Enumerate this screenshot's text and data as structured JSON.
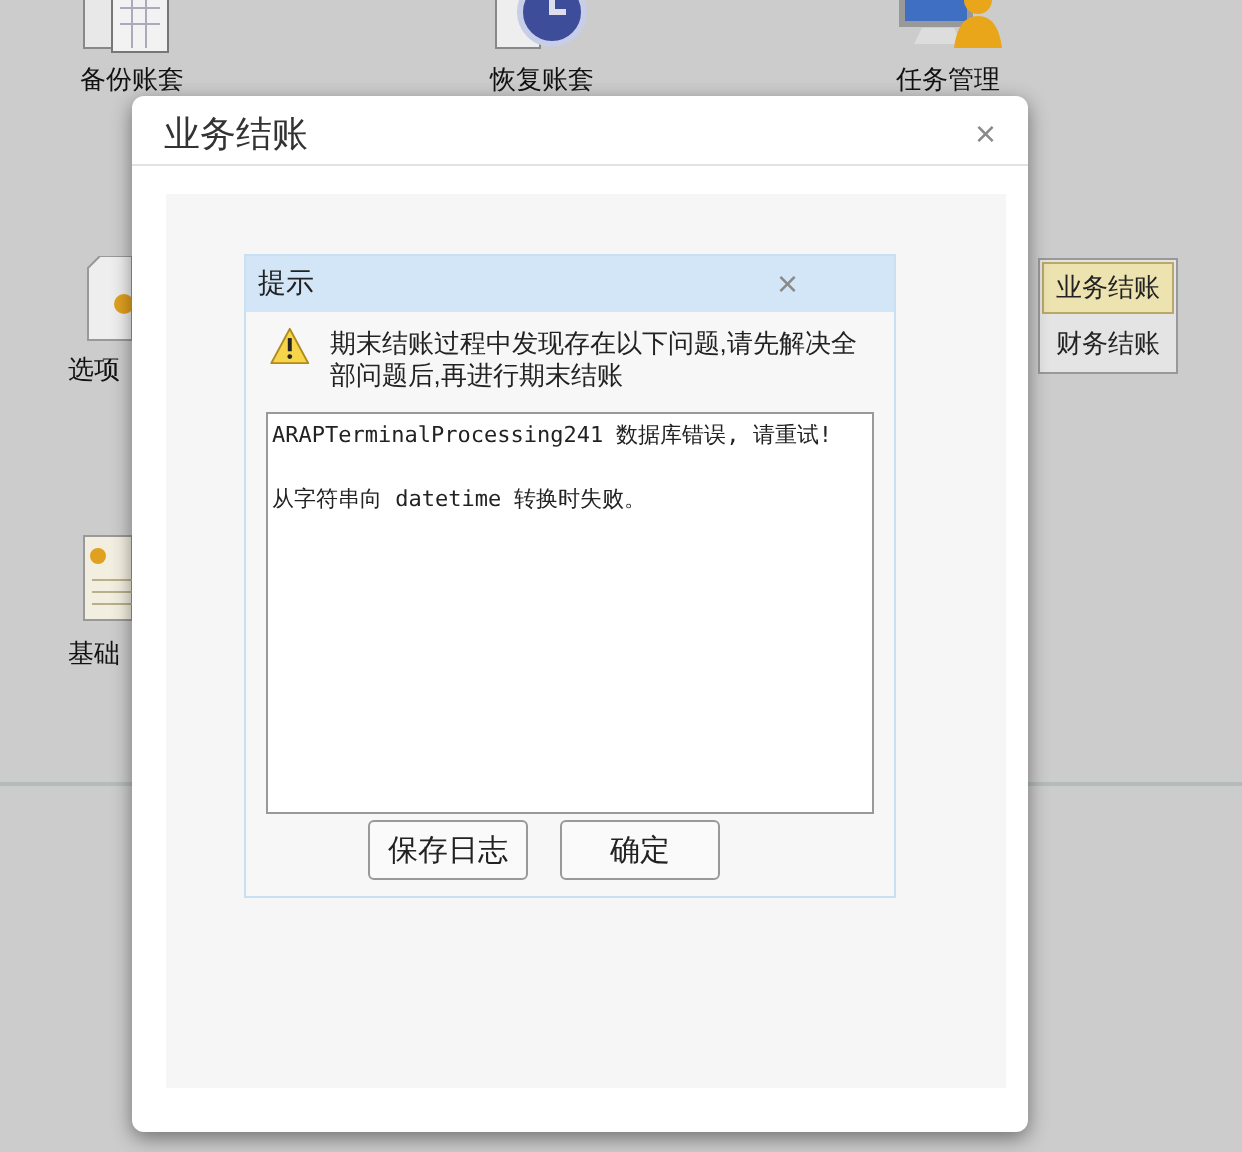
{
  "desktop_icons": [
    {
      "kind": "calendar",
      "label": "备份账套"
    },
    {
      "kind": "restore",
      "label": "恢复账套"
    },
    {
      "kind": "monitor",
      "label": "任务管理"
    },
    {
      "kind": "options",
      "label": "选项"
    },
    {
      "kind": "profile",
      "label": "基础"
    }
  ],
  "side_menu": [
    {
      "label": "业务结账",
      "selected": true
    },
    {
      "label": "财务结账",
      "selected": false
    }
  ],
  "dialog": {
    "title": "业务结账",
    "close": "×",
    "prompt": {
      "title": "提示",
      "close": "×",
      "message": "期末结账过程中发现存在以下问题,请先解决全部问题后,再进行期末结账",
      "log_lines": [
        "ARAPTerminalProcessing241 数据库错误, 请重试!",
        "从字符串向 datetime 转换时失败。"
      ],
      "buttons": [
        "保存日志",
        "确定"
      ]
    }
  }
}
